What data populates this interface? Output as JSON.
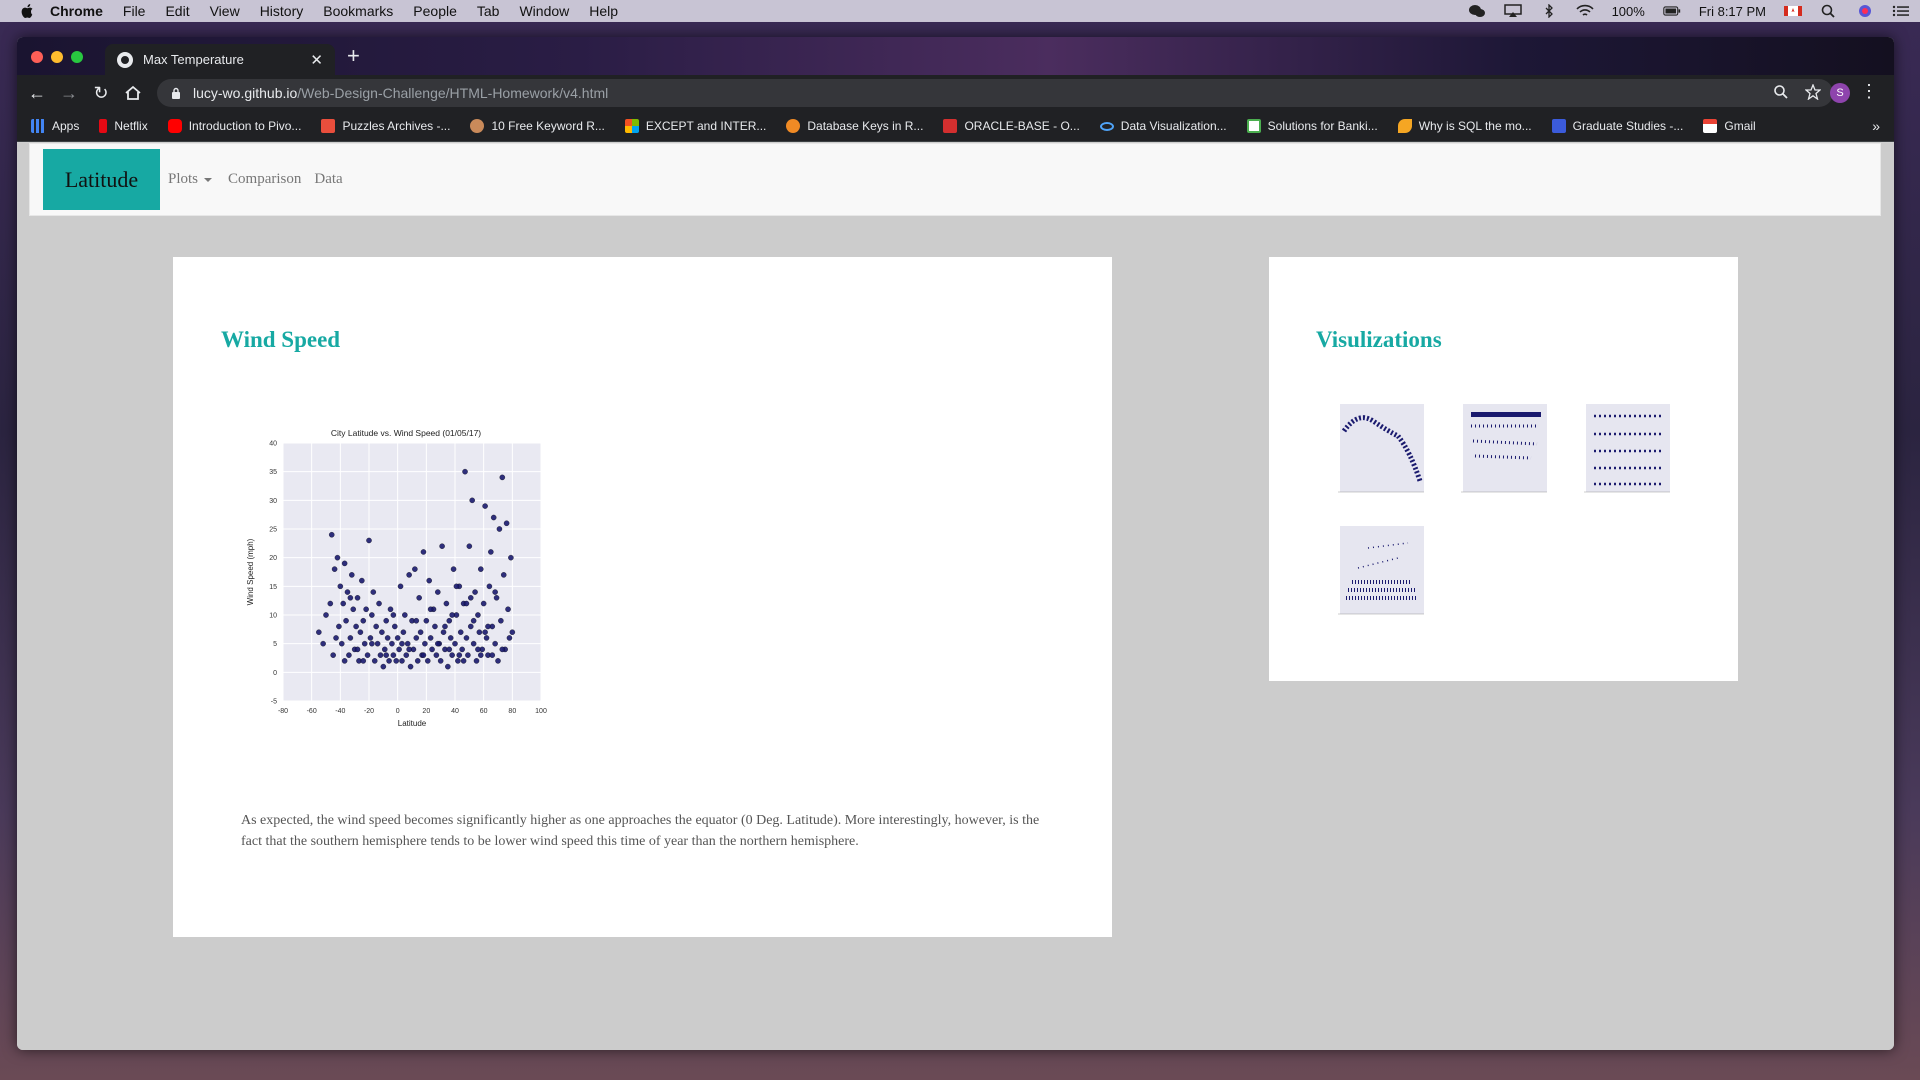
{
  "menubar": {
    "app": "Chrome",
    "items": [
      "File",
      "Edit",
      "View",
      "History",
      "Bookmarks",
      "People",
      "Tab",
      "Window",
      "Help"
    ],
    "battery": "100%",
    "clock": "Fri 8:17 PM"
  },
  "browser": {
    "tab_title": "Max Temperature",
    "url_domain": "lucy-wo.github.io",
    "url_path": "/Web-Design-Challenge/HTML-Homework/v4.html",
    "profile_initial": "S",
    "bookmarks": [
      {
        "label": "Apps",
        "icon": "apps-grid-icon",
        "color": "#4285f4"
      },
      {
        "label": "Netflix",
        "icon": "netflix-icon",
        "color": "#e50914"
      },
      {
        "label": "Introduction to Pivo...",
        "icon": "youtube-icon",
        "color": "#ff0000"
      },
      {
        "label": "Puzzles Archives -...",
        "icon": "puzzles-icon",
        "color": "#e94e3c"
      },
      {
        "label": "10 Free Keyword R...",
        "icon": "keyword-icon",
        "color": "#c98a5a"
      },
      {
        "label": "EXCEPT and INTER...",
        "icon": "microsoft-icon",
        "color": "#f25022"
      },
      {
        "label": "Database Keys in R...",
        "icon": "database-keys-icon",
        "color": "#f08a24"
      },
      {
        "label": "ORACLE-BASE - O...",
        "icon": "oracle-base-icon",
        "color": "#d32f2f"
      },
      {
        "label": "Data Visualization...",
        "icon": "infinity-icon",
        "color": "#4fa3f7"
      },
      {
        "label": "Solutions for Banki...",
        "icon": "solutions-icon",
        "color": "#4caf50"
      },
      {
        "label": "Why is SQL the mo...",
        "icon": "sql-icon",
        "color": "#f5a623"
      },
      {
        "label": "Graduate Studies -...",
        "icon": "graduate-studies-icon",
        "color": "#3b5bdb"
      },
      {
        "label": "Gmail",
        "icon": "gmail-icon",
        "color": "#ea4335"
      }
    ]
  },
  "page": {
    "brand": "Latitude",
    "nav": {
      "plots": "Plots",
      "comparison": "Comparison",
      "data": "Data"
    },
    "main_title": "Wind Speed",
    "description": "As expected, the wind speed becomes significantly higher as one approaches the equator (0 Deg. Latitude). More interestingly, however, is the fact that the southern hemisphere tends to be lower wind speed this time of year than the northern hemisphere.",
    "side_title": "Visulizations",
    "accent_color": "#17a9a3",
    "thumbnails": [
      "thumb-max-temperature",
      "thumb-humidity",
      "thumb-cloudiness",
      "thumb-wind-speed"
    ]
  },
  "chart_data": {
    "type": "scatter",
    "title": "City Latitude vs. Wind Speed (01/05/17)",
    "xlabel": "Latitude",
    "ylabel": "Wind Speed (mph)",
    "xlim": [
      -80,
      100
    ],
    "ylim": [
      -5,
      40
    ],
    "xticks": [
      -80,
      -60,
      -40,
      -20,
      0,
      20,
      40,
      60,
      80,
      100
    ],
    "yticks": [
      -5,
      0,
      5,
      10,
      15,
      20,
      25,
      30,
      35,
      40
    ],
    "grid": true,
    "point_color": "#1a1a6e",
    "points": [
      [
        -55,
        7
      ],
      [
        -52,
        5
      ],
      [
        -50,
        10
      ],
      [
        -47,
        12
      ],
      [
        -46,
        24
      ],
      [
        -45,
        3
      ],
      [
        -44,
        18
      ],
      [
        -42,
        20
      ],
      [
        -41,
        8
      ],
      [
        -40,
        15
      ],
      [
        -39,
        5
      ],
      [
        -38,
        12
      ],
      [
        -37,
        19
      ],
      [
        -36,
        9
      ],
      [
        -35,
        14
      ],
      [
        -34,
        3
      ],
      [
        -33,
        6
      ],
      [
        -32,
        17
      ],
      [
        -31,
        11
      ],
      [
        -30,
        4
      ],
      [
        -29,
        8
      ],
      [
        -28,
        13
      ],
      [
        -27,
        2
      ],
      [
        -26,
        7
      ],
      [
        -25,
        16
      ],
      [
        -24,
        9
      ],
      [
        -23,
        5
      ],
      [
        -22,
        11
      ],
      [
        -21,
        3
      ],
      [
        -20,
        23
      ],
      [
        -19,
        6
      ],
      [
        -18,
        10
      ],
      [
        -17,
        14
      ],
      [
        -16,
        2
      ],
      [
        -15,
        8
      ],
      [
        -14,
        5
      ],
      [
        -13,
        12
      ],
      [
        -12,
        3
      ],
      [
        -11,
        7
      ],
      [
        -10,
        1
      ],
      [
        -9,
        4
      ],
      [
        -8,
        9
      ],
      [
        -7,
        6
      ],
      [
        -6,
        2
      ],
      [
        -5,
        11
      ],
      [
        -4,
        5
      ],
      [
        -3,
        3
      ],
      [
        -2,
        8
      ],
      [
        -1,
        2
      ],
      [
        0,
        6
      ],
      [
        1,
        4
      ],
      [
        2,
        15
      ],
      [
        3,
        2
      ],
      [
        4,
        7
      ],
      [
        5,
        10
      ],
      [
        6,
        3
      ],
      [
        7,
        5
      ],
      [
        8,
        17
      ],
      [
        9,
        1
      ],
      [
        10,
        9
      ],
      [
        11,
        4
      ],
      [
        12,
        18
      ],
      [
        13,
        6
      ],
      [
        14,
        2
      ],
      [
        15,
        13
      ],
      [
        16,
        7
      ],
      [
        17,
        3
      ],
      [
        18,
        21
      ],
      [
        19,
        5
      ],
      [
        20,
        9
      ],
      [
        21,
        2
      ],
      [
        22,
        16
      ],
      [
        23,
        6
      ],
      [
        24,
        4
      ],
      [
        25,
        11
      ],
      [
        26,
        8
      ],
      [
        27,
        3
      ],
      [
        28,
        14
      ],
      [
        29,
        5
      ],
      [
        30,
        2
      ],
      [
        31,
        22
      ],
      [
        32,
        7
      ],
      [
        33,
        4
      ],
      [
        34,
        12
      ],
      [
        35,
        1
      ],
      [
        36,
        9
      ],
      [
        37,
        6
      ],
      [
        38,
        3
      ],
      [
        39,
        18
      ],
      [
        40,
        5
      ],
      [
        41,
        10
      ],
      [
        42,
        2
      ],
      [
        43,
        15
      ],
      [
        44,
        7
      ],
      [
        45,
        4
      ],
      [
        46,
        12
      ],
      [
        47,
        35
      ],
      [
        48,
        6
      ],
      [
        49,
        3
      ],
      [
        50,
        22
      ],
      [
        51,
        8
      ],
      [
        52,
        30
      ],
      [
        53,
        5
      ],
      [
        54,
        14
      ],
      [
        55,
        2
      ],
      [
        56,
        10
      ],
      [
        57,
        7
      ],
      [
        58,
        18
      ],
      [
        59,
        4
      ],
      [
        60,
        12
      ],
      [
        61,
        29
      ],
      [
        62,
        6
      ],
      [
        63,
        3
      ],
      [
        64,
        15
      ],
      [
        65,
        21
      ],
      [
        66,
        8
      ],
      [
        67,
        27
      ],
      [
        68,
        5
      ],
      [
        69,
        13
      ],
      [
        70,
        2
      ],
      [
        71,
        25
      ],
      [
        72,
        9
      ],
      [
        73,
        34
      ],
      [
        74,
        17
      ],
      [
        75,
        4
      ],
      [
        76,
        26
      ],
      [
        77,
        11
      ],
      [
        78,
        6
      ],
      [
        79,
        20
      ],
      [
        80,
        7
      ],
      [
        -43,
        6
      ],
      [
        -37,
        2
      ],
      [
        -33,
        13
      ],
      [
        -28,
        4
      ],
      [
        -24,
        2
      ],
      [
        -18,
        5
      ],
      [
        -8,
        3
      ],
      [
        -3,
        10
      ],
      [
        3,
        5
      ],
      [
        8,
        4
      ],
      [
        13,
        9
      ],
      [
        18,
        3
      ],
      [
        23,
        11
      ],
      [
        28,
        5
      ],
      [
        33,
        8
      ],
      [
        38,
        10
      ],
      [
        43,
        3
      ],
      [
        48,
        12
      ],
      [
        53,
        9
      ],
      [
        58,
        3
      ],
      [
        63,
        8
      ],
      [
        68,
        14
      ],
      [
        73,
        4
      ],
      [
        36,
        4
      ],
      [
        41,
        15
      ],
      [
        46,
        2
      ],
      [
        51,
        13
      ],
      [
        56,
        4
      ],
      [
        61,
        7
      ],
      [
        66,
        3
      ]
    ]
  }
}
